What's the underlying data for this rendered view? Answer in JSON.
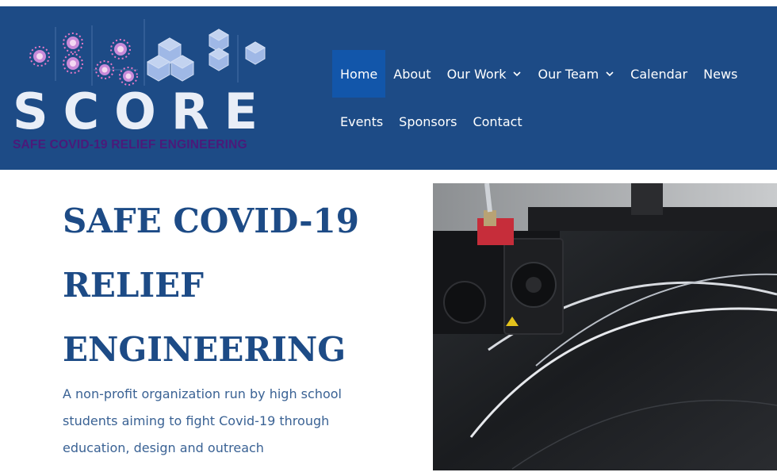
{
  "logo": {
    "wordmark": "SCORE",
    "tagline": "SAFE COVID-19 RELIEF ENGINEERING",
    "icon": "virus-and-cubes-logo"
  },
  "nav": {
    "items": [
      {
        "label": "Home",
        "active": true
      },
      {
        "label": "About"
      },
      {
        "label": "Our Work",
        "dropdown": true
      },
      {
        "label": "Our Team",
        "dropdown": true
      },
      {
        "label": "Calendar"
      },
      {
        "label": "News"
      },
      {
        "label": "Events"
      },
      {
        "label": "Sponsors"
      },
      {
        "label": "Contact"
      }
    ]
  },
  "hero": {
    "title": "SAFE COVID-19 RELIEF ENGINEERING",
    "subtitle": "A non-profit organization run by high school students aiming to fight Covid-19 through education, design and outreach",
    "image": "3d-printer-photo"
  },
  "colors": {
    "header_bg": "#1d4b86",
    "nav_active_bg": "#1256aa",
    "title": "#1d4b86",
    "subtitle": "#3a6294",
    "tagline": "#4b1a7a"
  }
}
